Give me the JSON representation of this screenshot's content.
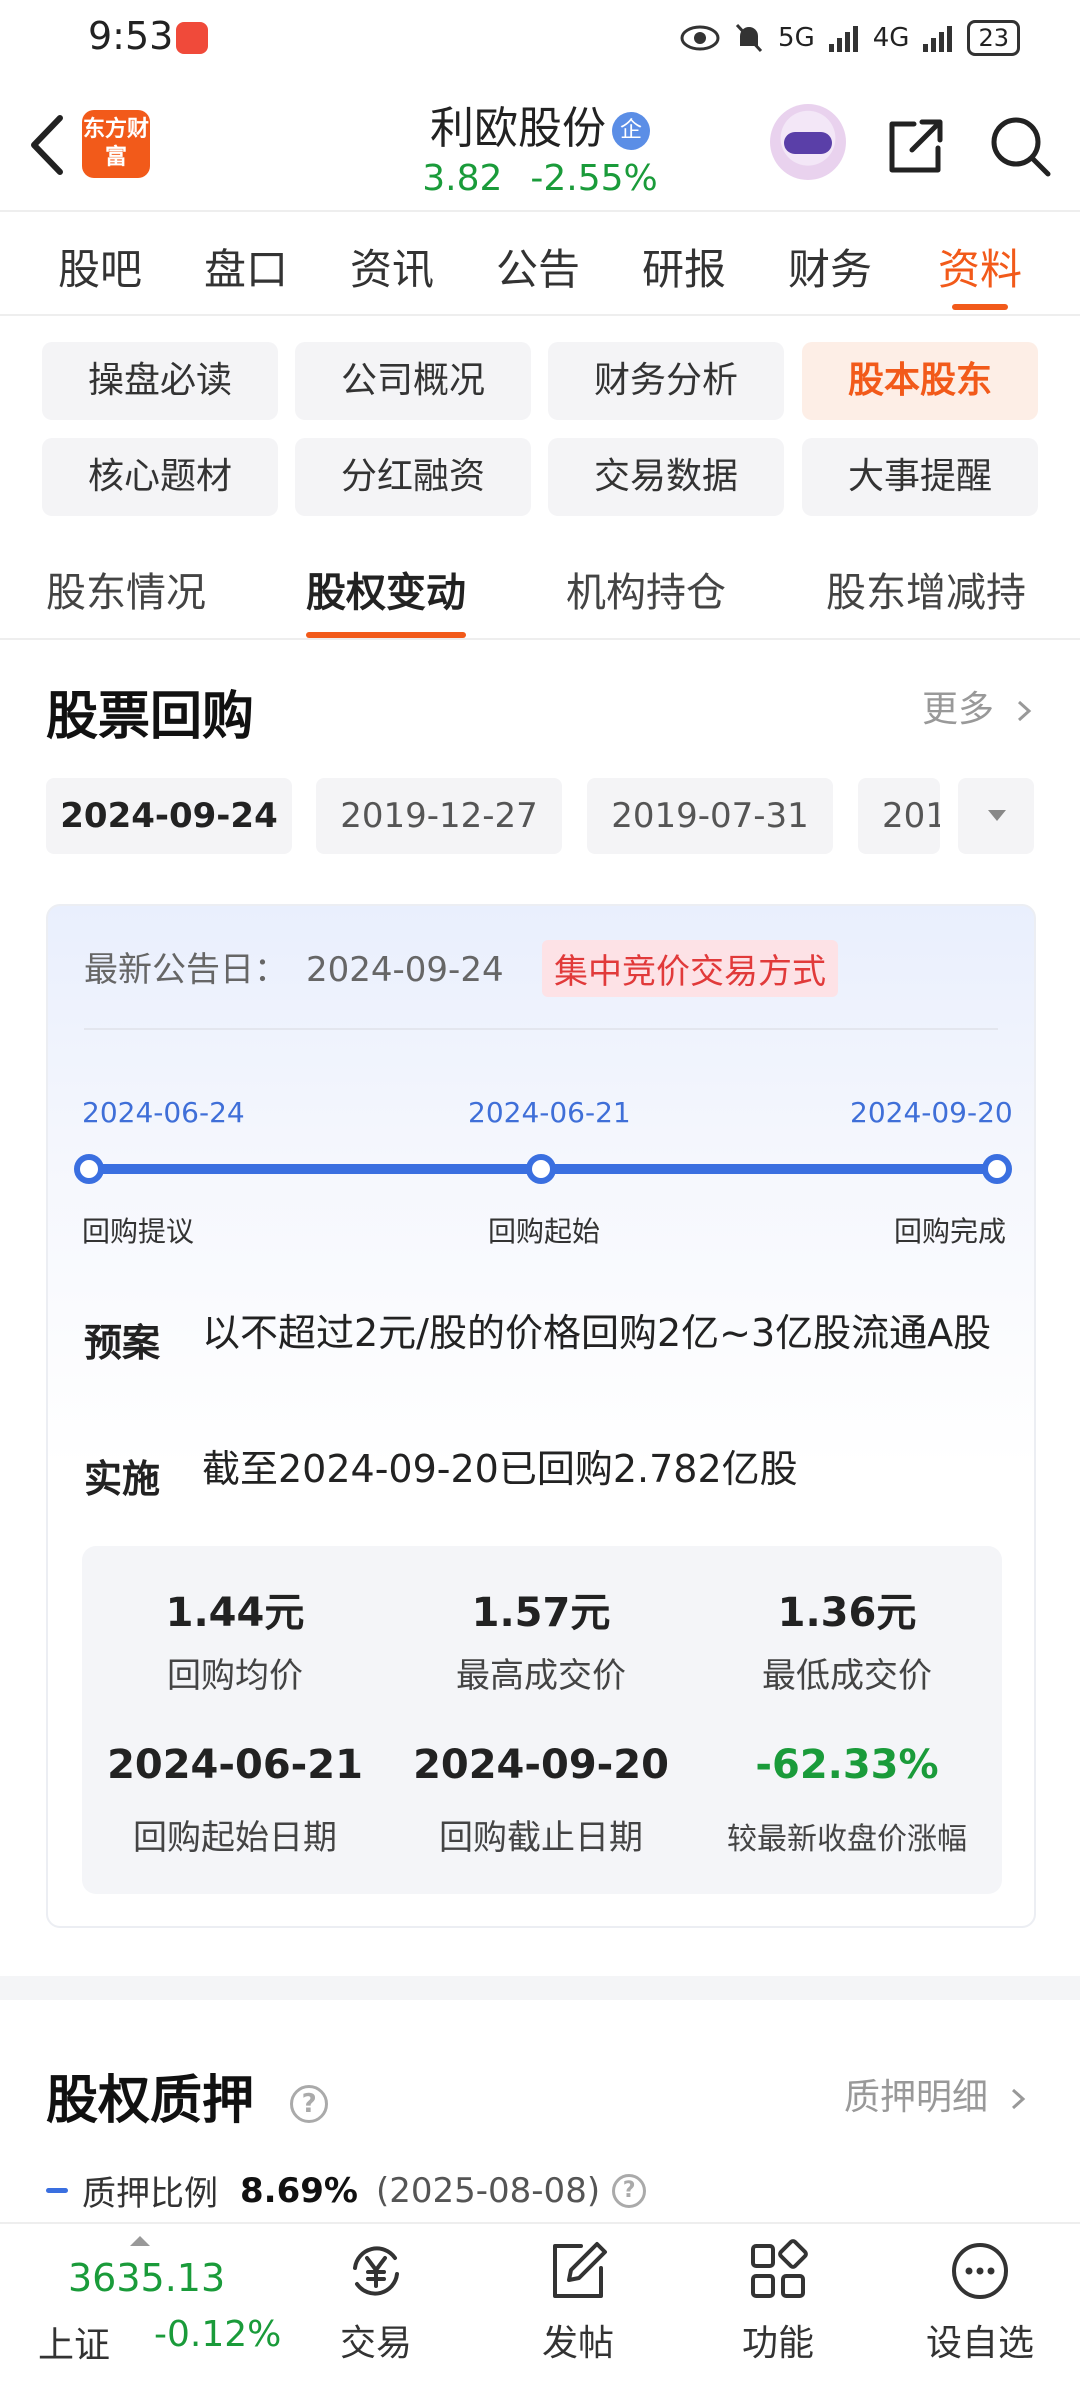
{
  "status_bar": {
    "time": "9:53",
    "net1": "5G",
    "net2": "4G",
    "battery": "23"
  },
  "header": {
    "logo_text": "东方财富",
    "stock_name": "利欧股份",
    "qi_badge": "企",
    "price": "3.82",
    "change_pct": "-2.55%"
  },
  "main_tabs": [
    "股吧",
    "盘口",
    "资讯",
    "公告",
    "研报",
    "财务",
    "资料"
  ],
  "sub_buttons": [
    "操盘必读",
    "公司概况",
    "财务分析",
    "股本股东",
    "核心题材",
    "分红融资",
    "交易数据",
    "大事提醒"
  ],
  "third_tabs": [
    "股东情况",
    "股权变动",
    "机构持仓",
    "股东增减持"
  ],
  "buyback": {
    "title": "股票回购",
    "more": "更多",
    "dates": [
      "2024-09-24",
      "2019-12-27",
      "2019-07-31",
      "201"
    ],
    "latest_label": "最新公告日：",
    "latest_date": "2024-09-24",
    "method_tag": "集中竞价交易方式",
    "timeline": [
      {
        "date": "2024-06-24",
        "label": "回购提议"
      },
      {
        "date": "2024-06-21",
        "label": "回购起始"
      },
      {
        "date": "2024-09-20",
        "label": "回购完成"
      }
    ],
    "plan_label": "预案",
    "plan_text": "以不超过2元/股的价格回购2亿~3亿股流通A股",
    "impl_label": "实施",
    "impl_text": "截至2024-09-20已回购2.782亿股",
    "stats": [
      {
        "value": "1.44元",
        "label": "回购均价"
      },
      {
        "value": "1.57元",
        "label": "最高成交价"
      },
      {
        "value": "1.36元",
        "label": "最低成交价"
      },
      {
        "value": "2024-06-21",
        "label": "回购起始日期"
      },
      {
        "value": "2024-09-20",
        "label": "回购截止日期"
      },
      {
        "value": "-62.33%",
        "label": "较最新收盘价涨幅"
      }
    ]
  },
  "pledge": {
    "title": "股权质押",
    "detail_link": "质押明细",
    "legend": "质押比例",
    "value": "8.69%",
    "date": "(2025-08-08)"
  },
  "bottom_bar": {
    "index_value": "3635.13",
    "index_name": "上证",
    "index_change": "-0.12%",
    "nav": [
      "交易",
      "发帖",
      "功能",
      "设自选"
    ]
  },
  "colors": {
    "accent": "#f25a1a",
    "down_green": "#1a9b3a",
    "timeline_blue": "#3a6fe0",
    "tag_red": "#e13a3a"
  }
}
